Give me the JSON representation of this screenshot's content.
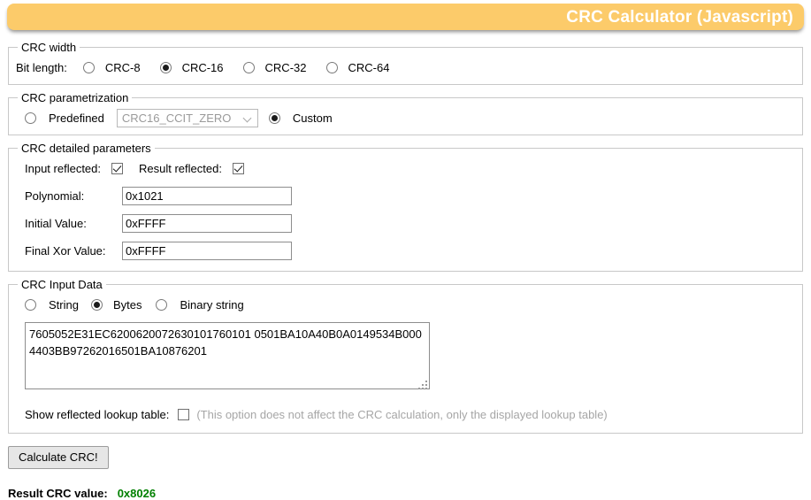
{
  "header": {
    "title": "CRC Calculator (Javascript)",
    "background_color": "#FCCB6A",
    "text_color": "#FFFFFF"
  },
  "crc_width": {
    "legend": "CRC width",
    "label": "Bit length:",
    "options": [
      {
        "label": "CRC-8",
        "selected": false
      },
      {
        "label": "CRC-16",
        "selected": true
      },
      {
        "label": "CRC-32",
        "selected": false
      },
      {
        "label": "CRC-64",
        "selected": false
      }
    ]
  },
  "parametrization": {
    "legend": "CRC parametrization",
    "predefined_label": "Predefined",
    "predefined_selected": false,
    "select_value": "CRC16_CCIT_ZERO",
    "select_disabled": true,
    "select_icon": "chevron-down-icon",
    "custom_label": "Custom",
    "custom_selected": true
  },
  "detailed": {
    "legend": "CRC detailed parameters",
    "input_reflected_label": "Input reflected:",
    "input_reflected_checked": true,
    "result_reflected_label": "Result reflected:",
    "result_reflected_checked": true,
    "fields": [
      {
        "label": "Polynomial:",
        "value": "0x1021"
      },
      {
        "label": "Initial Value:",
        "value": "0xFFFF"
      },
      {
        "label": "Final Xor Value:",
        "value": "0xFFFF"
      }
    ]
  },
  "input_data": {
    "legend": "CRC Input Data",
    "modes": [
      {
        "label": "String",
        "selected": false
      },
      {
        "label": "Bytes",
        "selected": true
      },
      {
        "label": "Binary string",
        "selected": false
      }
    ],
    "textarea_value": "7605052E31EC6200620072630101760101 0501BA10A40B0A0149534B0004403BB97262016501BA10876201",
    "textarea_line1": "7605052E31EC62006200726301017601010501BA10A40B0A0149534B",
    "textarea_line2": "0004403BB97262016501BA10876201",
    "resize_grip_icon": "resize-grip-icon"
  },
  "lookup": {
    "label": "Show reflected lookup table:",
    "checked": false,
    "hint": "(This option does not affect the CRC calculation, only the displayed lookup table)",
    "hint_color": "#A6A6A6"
  },
  "actions": {
    "calculate_label": "Calculate CRC!"
  },
  "result": {
    "label": "Result CRC value:",
    "value": "0x8026",
    "value_color": "#008000"
  }
}
